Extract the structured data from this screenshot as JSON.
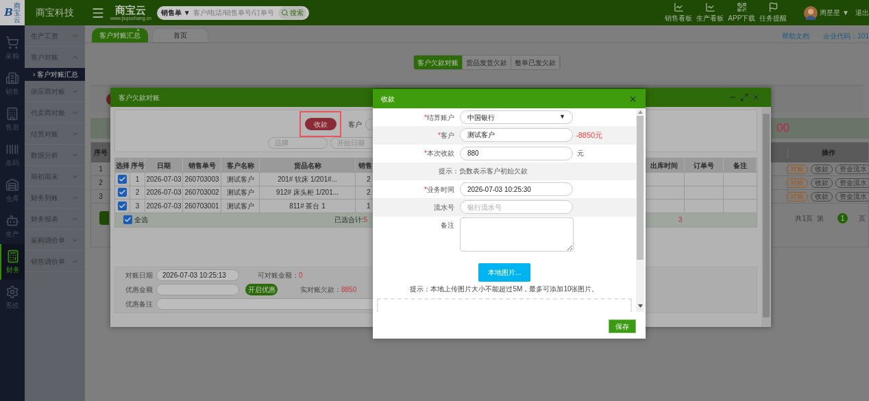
{
  "header": {
    "corner_logo": {
      "mark": "B",
      "text": "商宝云"
    },
    "brand": "商宝科技",
    "logo_text": "商宝云",
    "logo_url": "www.jiupuchang.cn",
    "search": {
      "type_select": "销售单 ▼",
      "placeholder": "客户/电话/销售单号/订单号",
      "button": "搜索"
    },
    "tools": [
      {
        "label": "销售看板"
      },
      {
        "label": "生产看板"
      },
      {
        "label": "APP下载"
      },
      {
        "label": "任务提醒"
      }
    ],
    "user": {
      "name": "周星星 ▼",
      "logout": "退出"
    }
  },
  "nav_rail": [
    {
      "label": "采购",
      "selected": false
    },
    {
      "label": "销售",
      "selected": false
    },
    {
      "label": "售后",
      "selected": false
    },
    {
      "label": "条码",
      "selected": false
    },
    {
      "label": "仓库",
      "selected": false
    },
    {
      "label": "生产",
      "selected": false
    },
    {
      "label": "财务",
      "selected": true
    },
    {
      "label": "系统",
      "selected": false
    }
  ],
  "submenu": [
    {
      "label": "生产工资",
      "expanded": false
    },
    {
      "label": "客户对账",
      "expanded": true,
      "children": [
        {
          "label": "› 客户对账汇总",
          "selected": true
        }
      ]
    },
    {
      "label": "供应商对账",
      "expanded": false
    },
    {
      "label": "代卖商对账",
      "expanded": false
    },
    {
      "label": "结算对账",
      "expanded": false
    },
    {
      "label": "数据分析",
      "expanded": false
    },
    {
      "label": "期初期末",
      "expanded": false
    },
    {
      "label": "财务到账",
      "expanded": false
    },
    {
      "label": "财务报表",
      "expanded": false
    },
    {
      "label": "采购调价单",
      "expanded": false
    },
    {
      "label": "销售调价单",
      "expanded": false
    }
  ],
  "tabs": [
    {
      "label": "客户对账汇总",
      "selected": true,
      "close": "×"
    },
    {
      "label": "首页",
      "selected": false
    }
  ],
  "links": [
    "帮助文档",
    "企业代码：101"
  ],
  "segments": [
    {
      "label": "客户欠款对账",
      "selected": true
    },
    {
      "label": "货品发货欠款",
      "selected": false
    },
    {
      "label": "整单已发欠款",
      "selected": false
    }
  ],
  "summary_fragment": "00",
  "main_table": {
    "columns": [
      "序号",
      "操作"
    ],
    "rows": [
      {
        "no": "1",
        "actions": [
          {
            "label": "对账",
            "highlighted": true
          },
          {
            "label": "收款",
            "highlighted": false
          },
          {
            "label": "资金流水",
            "highlighted": false
          }
        ]
      },
      {
        "no": "2",
        "actions": [
          {
            "label": "对账",
            "highlighted": true
          },
          {
            "label": "收款",
            "highlighted": false
          },
          {
            "label": "资金流水",
            "highlighted": false
          }
        ]
      },
      {
        "no": "3",
        "actions": [
          {
            "label": "对账",
            "highlighted": true
          },
          {
            "label": "收款",
            "highlighted": false
          },
          {
            "label": "资金流水",
            "highlighted": false
          }
        ]
      }
    ]
  },
  "pagination": {
    "total": "共1页",
    "prefix": "第",
    "page": "1",
    "suffix": "页"
  },
  "reconcile_dialog": {
    "title": "客户欠款对账",
    "collect_button": {
      "label": "收款",
      "highlighted": true
    },
    "customer_label": "客户",
    "filters": [
      {
        "placeholder": "品牌"
      },
      {
        "placeholder": "开始日期"
      }
    ],
    "columns": [
      "选择",
      "序号",
      "日期",
      "销售单号",
      "客户名称",
      "货品名称",
      "销售"
    ],
    "right_columns": [
      "出库时间",
      "订单号",
      "备注"
    ],
    "rows": [
      {
        "checked": true,
        "no": "1",
        "date": "2026-07-03",
        "order": "260703003",
        "customer": "测试客户",
        "goods": "201# 软床 1/201#...",
        "qty": "2"
      },
      {
        "checked": true,
        "no": "2",
        "date": "2026-07-03",
        "order": "260703002",
        "customer": "测试客户",
        "goods": "912# 床头柜 1/201...",
        "qty": "2"
      },
      {
        "checked": true,
        "no": "3",
        "date": "2026-07-03",
        "order": "260703001",
        "customer": "测试客户",
        "goods": "811# 茶台 1",
        "qty": "1"
      }
    ],
    "select_all": {
      "label": "全选",
      "checked": true
    },
    "selected_total": {
      "label": "已选合计:",
      "value": "5"
    },
    "total_fragment": "3",
    "footer": {
      "date_label": "对账日期",
      "date_value": "2026-07-03 10:25:13",
      "available_label": "可对账金额：",
      "available_value": "0",
      "discount_label": "优惠金额",
      "discount_button": "开启优惠",
      "due_label": "实对账欠款：",
      "due_value": "8850",
      "note_label": "优惠备注"
    }
  },
  "payment_dialog": {
    "title": "收款",
    "fields": [
      {
        "kind": "select",
        "required_mark": "*",
        "label": "结算账户",
        "value": "中国银行",
        "caret": "▼"
      },
      {
        "kind": "input",
        "required_mark": "*",
        "label": "客户",
        "value": "测试客户",
        "suffix": "-8850元",
        "suffix_alert": true
      },
      {
        "kind": "input",
        "required_mark": "*",
        "label": "本次收款",
        "value": "880",
        "suffix": "元",
        "suffix_alert": false
      },
      {
        "kind": "hint",
        "text": "提示：负数表示客户初始欠款"
      },
      {
        "kind": "input",
        "required_mark": "*",
        "label": "业务时间",
        "value": "2026-07-03 10:25:30"
      },
      {
        "kind": "input",
        "label": "流水号",
        "placeholder": "银行流水号"
      },
      {
        "kind": "textarea",
        "label": "备注"
      }
    ],
    "upload_button": "本地图片...",
    "upload_hint": "提示：本地上传图片大小不能超过5M，最多可添加10张图片。",
    "save_button": "保存"
  }
}
